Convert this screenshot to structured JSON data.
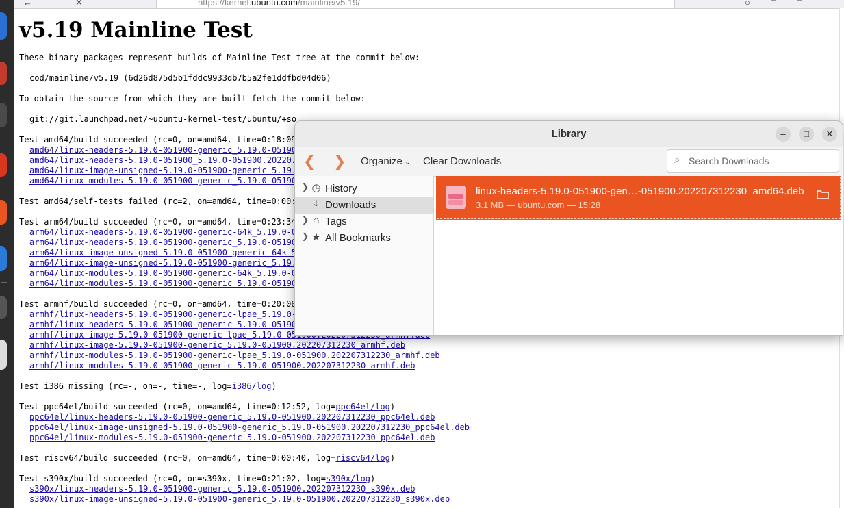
{
  "browser": {
    "url_prefix": "https://kernel.",
    "url_domain": "ubuntu.com",
    "url_suffix": "/mainline/v5.19/"
  },
  "page": {
    "title": "v5.19 Mainline Test",
    "intro": "These binary packages represent builds of Mainline Test tree at the commit below:",
    "commit_ref": "cod/mainline/v5.19 (6d26d875d5b1fddc9933db7b5a2fe1ddfbd04d06)",
    "source_intro": "To obtain the source from which they are built fetch the commit below:",
    "git_url": "git://git.launchpad.net/~ubuntu-kernel-test/ubuntu/+so",
    "sections": [
      {
        "status": "Test amd64/build succeeded (rc=0, on=amd64, time=0:18:09",
        "links": [
          "amd64/linux-headers-5.19.0-051900-generic_5.19.0-051900",
          "amd64/linux-headers-5.19.0-051900_5.19.0-051900.202207",
          "amd64/linux-image-unsigned-5.19.0-051900-generic_5.19.",
          "amd64/linux-modules-5.19.0-051900-generic_5.19.0-05190"
        ]
      },
      {
        "status": "Test amd64/self-tests failed (rc=2, on=amd64, time=0:00:",
        "links": []
      },
      {
        "status": "Test arm64/build succeeded (rc=0, on=amd64, time=0:23:34",
        "links": [
          "arm64/linux-headers-5.19.0-051900-generic-64k_5.19.0-0",
          "arm64/linux-headers-5.19.0-051900-generic_5.19.0-05190",
          "arm64/linux-image-unsigned-5.19.0-051900-generic-64k_5",
          "arm64/linux-image-unsigned-5.19.0-051900-generic_5.19.",
          "arm64/linux-modules-5.19.0-051900-generic-64k_5.19.0-0",
          "arm64/linux-modules-5.19.0-051900-generic_5.19.0-05190"
        ]
      },
      {
        "status": "Test armhf/build succeeded (rc=0, on=amd64, time=0:20:08",
        "links": [
          "armhf/linux-headers-5.19.0-051900-generic-lpae_5.19.0-",
          "armhf/linux-headers-5.19.0-051900-generic_5.19.0-05190",
          "armhf/linux-image-5.19.0-051900-generic-lpae_5.19.0-051900.202207312230_armhf.deb",
          "armhf/linux-image-5.19.0-051900-generic_5.19.0-051900.202207312230_armhf.deb",
          "armhf/linux-modules-5.19.0-051900-generic-lpae_5.19.0-051900.202207312230_armhf.deb",
          "armhf/linux-modules-5.19.0-051900-generic_5.19.0-051900.202207312230_armhf.deb"
        ]
      },
      {
        "status": "Test i386 missing (rc=-, on=-, time=-, log=",
        "log_link": "i386/log",
        "status_end": ")",
        "links": []
      },
      {
        "status": "Test ppc64el/build succeeded (rc=0, on=amd64, time=0:12:52, log=",
        "log_link": "ppc64el/log",
        "status_end": ")",
        "links": [
          "ppc64el/linux-headers-5.19.0-051900-generic_5.19.0-051900.202207312230_ppc64el.deb",
          "ppc64el/linux-image-unsigned-5.19.0-051900-generic_5.19.0-051900.202207312230_ppc64el.deb",
          "ppc64el/linux-modules-5.19.0-051900-generic_5.19.0-051900.202207312230_ppc64el.deb"
        ]
      },
      {
        "status": "Test riscv64/build succeeded (rc=0, on=amd64, time=0:00:40, log=",
        "log_link": "riscv64/log",
        "status_end": ")",
        "links": []
      },
      {
        "status": "Test s390x/build succeeded (rc=0, on=s390x, time=0:21:02, log=",
        "log_link": "s390x/log",
        "status_end": ")",
        "links": [
          "s390x/linux-headers-5.19.0-051900-generic_5.19.0-051900.202207312230_s390x.deb",
          "s390x/linux-image-unsigned-5.19.0-051900-generic_5.19.0-051900.202207312230_s390x.deb"
        ]
      }
    ]
  },
  "library": {
    "title": "Library",
    "toolbar": {
      "organize_label": "Organize",
      "clear_label": "Clear Downloads",
      "search_placeholder": "Search Downloads"
    },
    "sidebar": [
      {
        "label": "History",
        "icon": "clock-icon",
        "expandable": true
      },
      {
        "label": "Downloads",
        "icon": "download-icon",
        "expandable": false,
        "selected": true
      },
      {
        "label": "Tags",
        "icon": "tag-icon",
        "expandable": true
      },
      {
        "label": "All Bookmarks",
        "icon": "star-icon",
        "expandable": true
      }
    ],
    "download": {
      "filename": "linux-headers-5.19.0-051900-gen…-051900.202207312230_amd64.deb",
      "meta": "3.1 MB — ubuntu.com — 15:28"
    },
    "accent_color": "#e95420"
  }
}
